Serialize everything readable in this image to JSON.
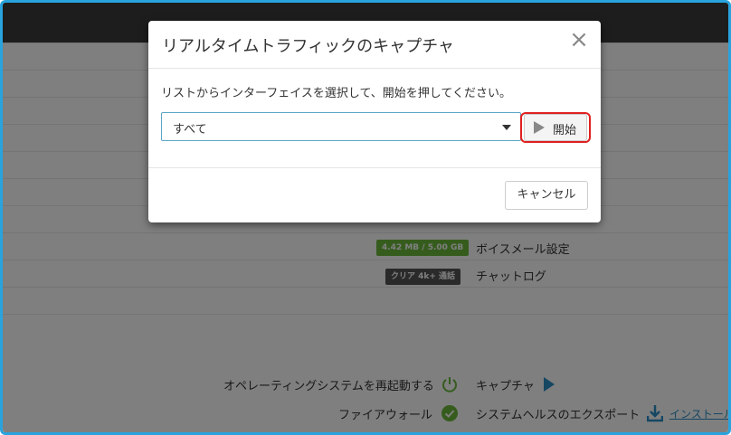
{
  "background": {
    "rows": [
      {
        "badge": "4.42 MB / 5.00 GB",
        "badge_color": "green",
        "label": "ボイスメール設定"
      },
      {
        "badge": "クリア 4k+ 通話",
        "badge_color": "dark",
        "label": "チャットログ"
      }
    ],
    "actions_left": [
      {
        "label": "オペレーティングシステムを再起動する",
        "icon": "power-icon"
      },
      {
        "label": "ファイアウォール",
        "icon": "check-icon"
      }
    ],
    "actions_right": [
      {
        "label": "キャプチャ",
        "icon": "play-icon"
      },
      {
        "label": "システムヘルスのエクスポート",
        "icon": "download-icon",
        "link": "インストール"
      }
    ]
  },
  "dialog": {
    "title": "リアルタイムトラフィックのキャプチャ",
    "close_label": "×",
    "instruction": "リストからインターフェイスを選択して、開始を押してください。",
    "interface_select": {
      "value": "すべて"
    },
    "start_label": "開始",
    "cancel_label": "キャンセル"
  },
  "colors": {
    "accent": "#29a3dd",
    "highlight": "#e02020",
    "success": "#6bb83b",
    "link": "#2a8fc6"
  }
}
